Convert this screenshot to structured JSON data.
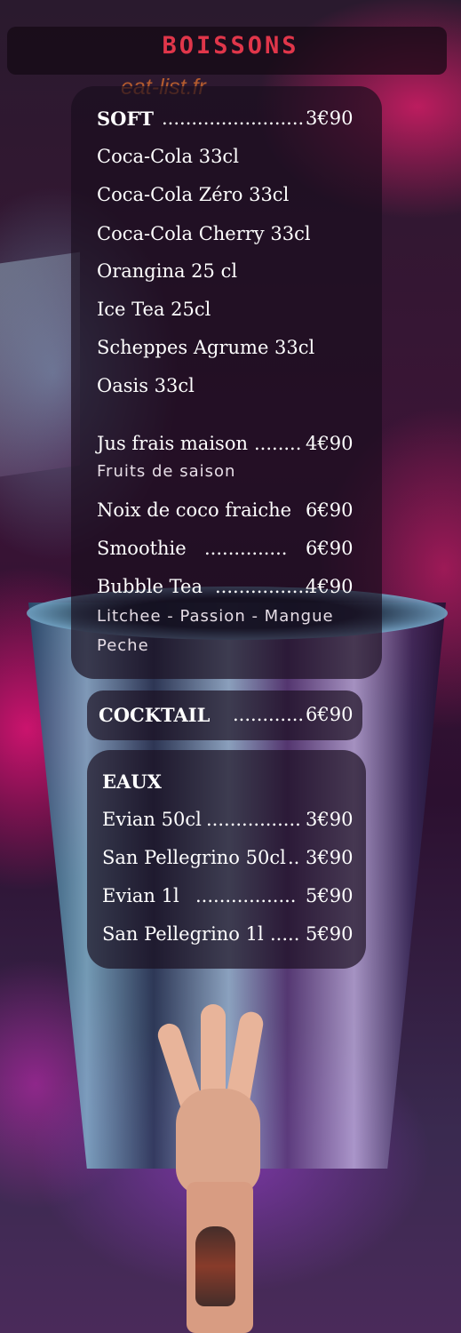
{
  "header": {
    "title": "Boissons",
    "watermark": "eat-list.fr"
  },
  "soft": {
    "heading": "SOFT",
    "heading_dots": "........................",
    "heading_price": "3€90",
    "items": [
      "Coca-Cola 33cl",
      "Coca-Cola Zéro 33cl",
      "Coca-Cola Cherry 33cl",
      "Orangina 25 cl",
      "Ice Tea 25cl",
      "Scheppes Agrume 33cl",
      "Oasis 33cl"
    ],
    "jus": {
      "label": "Jus frais maison",
      "dots": "........",
      "price": "4€90",
      "note": "Fruits de saison"
    },
    "coco": {
      "label": "Noix de coco fraiche",
      "price": "6€90"
    },
    "smoothie": {
      "label": "Smoothie",
      "dots": "..............",
      "price": "6€90"
    },
    "bubble": {
      "label": "Bubble Tea",
      "dots": "................",
      "price": "4€90",
      "note_line1": "Litchee - Passion - Mangue",
      "note_line2": "Peche"
    }
  },
  "cocktail": {
    "label": "COCKTAIL",
    "dots": "............",
    "price": "6€90"
  },
  "eaux": {
    "heading": "EAUX",
    "items": [
      {
        "label": "Evian 50cl",
        "dots": "................",
        "price": "3€90"
      },
      {
        "label": "San Pellegrino 50cl",
        "dots": "..",
        "price": "3€90"
      },
      {
        "label": "Evian  1l",
        "dots": ".................",
        "price": "5€90"
      },
      {
        "label": "San Pellegrino 1l",
        "dots": ".....",
        "price": "5€90"
      }
    ]
  },
  "colors": {
    "title_red": "#e0364a",
    "watermark_orange": "#c2632e",
    "panel": "#190e1e"
  },
  "icons": [
    "cocktail-shaker-image",
    "three-fingers-hand-image"
  ]
}
